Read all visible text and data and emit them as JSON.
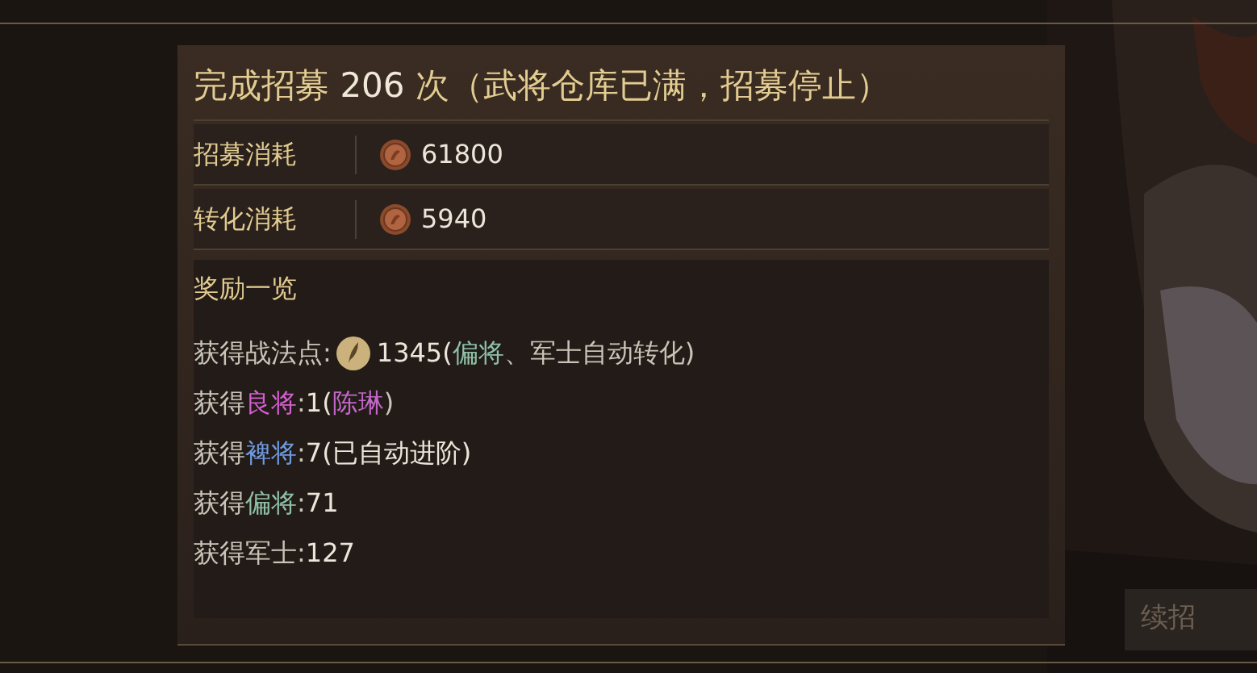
{
  "title": [
    {
      "text": "完成招募 ",
      "color": "#e3cc91"
    },
    {
      "text": "206",
      "color": "#f0e8d8"
    },
    {
      "text": " 次（武将仓库已满，招募停止）",
      "color": "#e3cc91"
    }
  ],
  "costs": [
    {
      "label": "招募消耗",
      "value": "61800"
    },
    {
      "label": "转化消耗",
      "value": "5940"
    }
  ],
  "rewards_title": "奖励一览",
  "rewards": [
    {
      "kind": "points",
      "parts": [
        {
          "text": "获得战法点:",
          "color": "#c9c4b8"
        },
        {
          "text": "1345(",
          "color": "#ece6da"
        },
        {
          "text": "偏将",
          "color": "#8fc0a8"
        },
        {
          "text": "、军士自动转化)",
          "color": "#c9c4b8"
        }
      ]
    },
    {
      "kind": "plain",
      "parts": [
        {
          "text": "获得",
          "color": "#c9c4b8"
        },
        {
          "text": "良将",
          "color": "#d35fcf"
        },
        {
          "text": ":",
          "color": "#c9c4b8"
        },
        {
          "text": "1(",
          "color": "#ece6da"
        },
        {
          "text": "陈琳",
          "color": "#c167c8"
        },
        {
          "text": ")",
          "color": "#c9c4b8"
        }
      ]
    },
    {
      "kind": "plain",
      "parts": [
        {
          "text": "获得",
          "color": "#c9c4b8"
        },
        {
          "text": "裨将",
          "color": "#6f9be0"
        },
        {
          "text": ":",
          "color": "#c9c4b8"
        },
        {
          "text": "7(已自动进阶)",
          "color": "#ece6da"
        }
      ]
    },
    {
      "kind": "plain",
      "parts": [
        {
          "text": "获得",
          "color": "#c9c4b8"
        },
        {
          "text": "偏将",
          "color": "#8fc0a8"
        },
        {
          "text": ":",
          "color": "#c9c4b8"
        },
        {
          "text": "71",
          "color": "#ece6da"
        }
      ]
    },
    {
      "kind": "plain",
      "parts": [
        {
          "text": "获得军士:",
          "color": "#c9c4b8"
        },
        {
          "text": "127",
          "color": "#ece6da"
        }
      ]
    }
  ],
  "side_button": "续招"
}
